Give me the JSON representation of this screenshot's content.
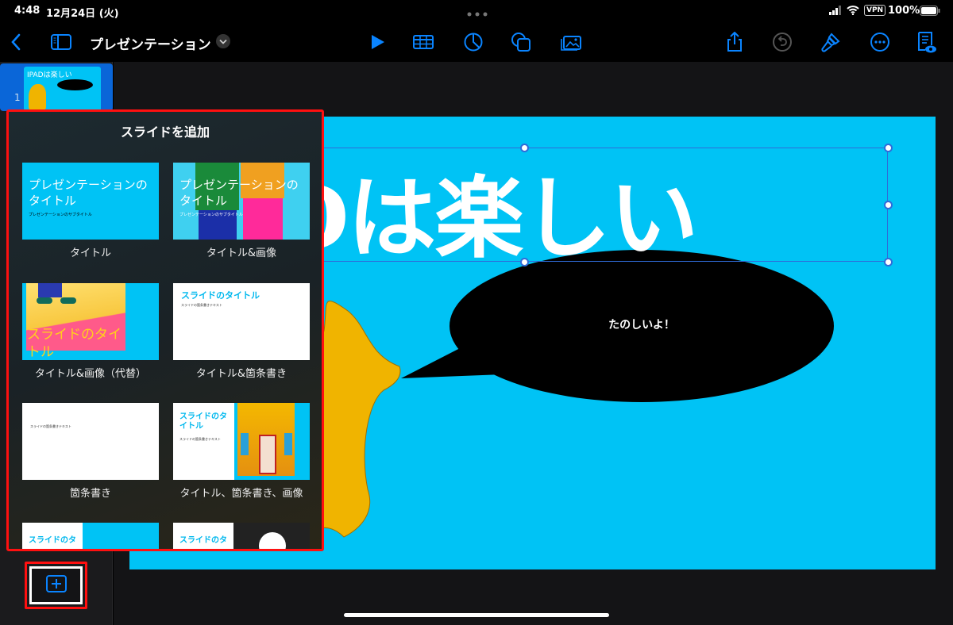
{
  "status_bar": {
    "time": "4:48",
    "date": "12月24日 (火)",
    "vpn": "VPN",
    "battery": "100%"
  },
  "toolbar": {
    "title": "プレゼンテーション",
    "icons": [
      "back-icon",
      "sidebar-icon",
      "title-menu-chevron-icon",
      "play-icon",
      "table-icon",
      "chart-icon",
      "shape-icon",
      "media-icon",
      "share-icon",
      "undo-icon",
      "format-brush-icon",
      "more-icon",
      "presenter-notes-icon"
    ]
  },
  "navigator": {
    "slides": [
      {
        "number": "1",
        "title": "IPADは楽しい"
      }
    ],
    "add_slide_icon": "plus-icon"
  },
  "slide": {
    "title": "IPADは楽しい",
    "bubble_text": "たのしいよ！",
    "background": "#00c3f5"
  },
  "add_slide_popover": {
    "title": "スライドを追加",
    "layouts": [
      {
        "label": "タイトル",
        "title": "プレゼンテーションのタイトル",
        "subtitle": "プレゼンテーションのサブタイトル"
      },
      {
        "label": "タイトル&画像",
        "title": "プレゼンテーションのタイトル",
        "subtitle": "プレゼンテーションのサブタイトル"
      },
      {
        "label": "タイトル&画像（代替）",
        "title": "スライドのタイトル"
      },
      {
        "label": "タイトル&箇条書き",
        "title": "スライドのタイトル",
        "bullet": "スライドの箇条書きテキスト"
      },
      {
        "label": "箇条書き",
        "bullet": "スライドの箇条書きテキスト"
      },
      {
        "label": "タイトル、箇条書き、画像",
        "title": "スライドのタイトル",
        "bullet": "スライドの箇条書きテキスト"
      },
      {
        "title": "スライドのタ"
      },
      {
        "title": "スライドのタ"
      }
    ]
  },
  "colors": {
    "accent": "#0a84ff",
    "highlight": "#ff1010",
    "slide": "#00c3f5",
    "rabbit": "#f0b400"
  }
}
